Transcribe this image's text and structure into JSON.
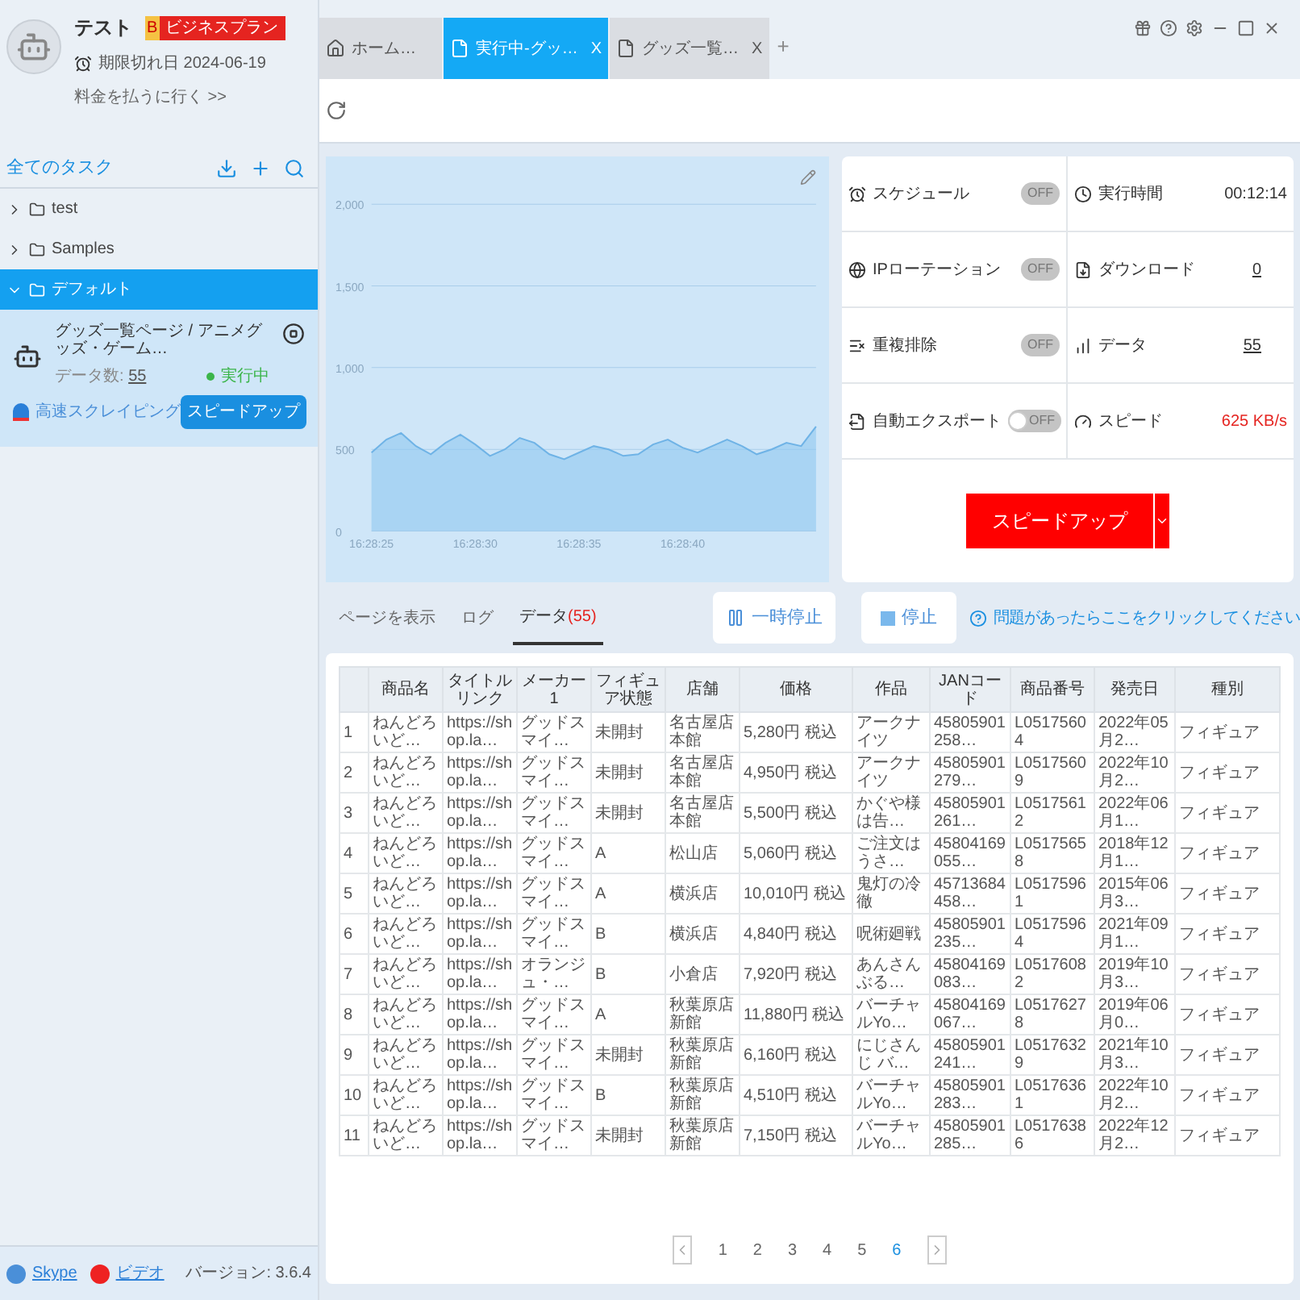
{
  "user": {
    "name": "テスト",
    "plan_badge": "ビジネスプラン",
    "plan_mark": "B",
    "expiry": "期限切れ日 2024-06-19",
    "pay_link": "料金を払うに行く >>"
  },
  "tabs": [
    {
      "label": "ホーム…",
      "kind": "home",
      "selected": false
    },
    {
      "label": "実行中-グッ…",
      "kind": "page",
      "selected": true,
      "close": "X"
    },
    {
      "label": "グッズ一覧…",
      "kind": "page",
      "selected": false,
      "close": "X"
    }
  ],
  "tab_add": "+",
  "sidebar": {
    "title": "全てのタスク",
    "folders": [
      {
        "label": "test",
        "expanded": false,
        "selected": false
      },
      {
        "label": "Samples",
        "expanded": false,
        "selected": false
      },
      {
        "label": "デフォルト",
        "expanded": true,
        "selected": true
      }
    ],
    "task": {
      "title": "グッズ一覧ページ / アニメグッズ・ゲーム…",
      "count_label": "データ数:",
      "count": "55",
      "status": "実行中",
      "mode": "高速スクレイピング",
      "speed_button": "スピードアップ"
    },
    "footer": {
      "skype": "Skype",
      "video": "ビデオ",
      "version": "バージョン: 3.6.4"
    }
  },
  "chart_data": {
    "type": "area",
    "categories": [
      "16:28:25",
      null,
      null,
      null,
      null,
      null,
      null,
      "16:28:30",
      null,
      null,
      null,
      null,
      null,
      null,
      "16:28:35",
      null,
      null,
      null,
      null,
      null,
      null,
      "16:28:40",
      null,
      null,
      null,
      null,
      null,
      null,
      null,
      null,
      null
    ],
    "series": [
      {
        "color": "#90c8f0",
        "values": [
          480,
          560,
          600,
          520,
          470,
          540,
          590,
          530,
          460,
          500,
          570,
          540,
          470,
          440,
          480,
          520,
          500,
          460,
          470,
          530,
          560,
          510,
          480,
          520,
          560,
          520,
          470,
          500,
          540,
          520,
          640
        ]
      }
    ],
    "ylim": [
      0,
      2000
    ],
    "grid": true,
    "yticks": [
      {
        "value": 0,
        "label": "0"
      },
      {
        "value": 500,
        "label": "500"
      },
      {
        "value": 1000,
        "label": "1,000"
      },
      {
        "value": 1500,
        "label": "1,500"
      },
      {
        "value": 2000,
        "label": "2,000"
      }
    ]
  },
  "settings": [
    {
      "label": "スケジュール",
      "toggle": "OFF",
      "disabled": true
    },
    {
      "label": "IPローテーション",
      "toggle": "OFF",
      "disabled": true
    },
    {
      "label": "重複排除",
      "toggle": "OFF",
      "disabled": true
    },
    {
      "label": "自動エクスポート",
      "toggle": "OFF",
      "disabled": false
    }
  ],
  "stats": [
    {
      "label": "実行時間",
      "value": "00:12:14",
      "kind": "text"
    },
    {
      "label": "ダウンロード",
      "value": "0",
      "kind": "link"
    },
    {
      "label": "データ",
      "value": "55",
      "kind": "link"
    },
    {
      "label": "スピード",
      "value": "625 KB/s",
      "kind": "alert"
    }
  ],
  "speed_up": "スピードアップ",
  "view_tabs": [
    {
      "label": "ページを表示",
      "selected": false
    },
    {
      "label": "ログ",
      "selected": false
    },
    {
      "label": "データ",
      "count": "(55)",
      "selected": true
    }
  ],
  "pause": "一時停止",
  "stop": "停止",
  "help": "問題があったらここをクリックしてください",
  "table": {
    "columns": [
      "",
      "商品名",
      "タイトルリンク",
      "メーカー1",
      "フィギュア状態",
      "店舗",
      "価格",
      "作品",
      "JANコード",
      "商品番号",
      "発売日",
      "種別"
    ],
    "rows": [
      [
        "1",
        "ねんどろいど…",
        "https://shop.la…",
        "グッドスマイ…",
        "未開封",
        "名古屋店本館",
        "5,280円 税込",
        "アークナイツ",
        "45805901258…",
        "L05175604",
        "2022年05月2…",
        "フィギュア"
      ],
      [
        "2",
        "ねんどろいど…",
        "https://shop.la…",
        "グッドスマイ…",
        "未開封",
        "名古屋店本館",
        "4,950円 税込",
        "アークナイツ",
        "45805901279…",
        "L05175609",
        "2022年10月2…",
        "フィギュア"
      ],
      [
        "3",
        "ねんどろいど…",
        "https://shop.la…",
        "グッドスマイ…",
        "未開封",
        "名古屋店本館",
        "5,500円 税込",
        "かぐや様は告…",
        "45805901261…",
        "L05175612",
        "2022年06月1…",
        "フィギュア"
      ],
      [
        "4",
        "ねんどろいど…",
        "https://shop.la…",
        "グッドスマイ…",
        "A",
        "松山店",
        "5,060円 税込",
        "ご注文はうさ…",
        "45804169055…",
        "L05175658",
        "2018年12月1…",
        "フィギュア"
      ],
      [
        "5",
        "ねんどろいど…",
        "https://shop.la…",
        "グッドスマイ…",
        "A",
        "横浜店",
        "10,010円 税込",
        "鬼灯の冷徹",
        "45713684458…",
        "L05175961",
        "2015年06月3…",
        "フィギュア"
      ],
      [
        "6",
        "ねんどろいど…",
        "https://shop.la…",
        "グッドスマイ…",
        "B",
        "横浜店",
        "4,840円 税込",
        "呪術廻戦",
        "45805901235…",
        "L05175964",
        "2021年09月1…",
        "フィギュア"
      ],
      [
        "7",
        "ねんどろいど…",
        "https://shop.la…",
        "オランジュ・…",
        "B",
        "小倉店",
        "7,920円 税込",
        "あんさんぶる…",
        "45804169083…",
        "L05176082",
        "2019年10月3…",
        "フィギュア"
      ],
      [
        "8",
        "ねんどろいど…",
        "https://shop.la…",
        "グッドスマイ…",
        "A",
        "秋葉原店新館",
        "11,880円 税込",
        "バーチャルYo…",
        "45804169067…",
        "L05176278",
        "2019年06月0…",
        "フィギュア"
      ],
      [
        "9",
        "ねんどろいど…",
        "https://shop.la…",
        "グッドスマイ…",
        "未開封",
        "秋葉原店新館",
        "6,160円 税込",
        "にじさんじ バ…",
        "45805901241…",
        "L05176329",
        "2021年10月3…",
        "フィギュア"
      ],
      [
        "10",
        "ねんどろいど…",
        "https://shop.la…",
        "グッドスマイ…",
        "B",
        "秋葉原店新館",
        "4,510円 税込",
        "バーチャルYo…",
        "45805901283…",
        "L05176361",
        "2022年10月2…",
        "フィギュア"
      ],
      [
        "11",
        "ねんどろいど…",
        "https://shop.la…",
        "グッドスマイ…",
        "未開封",
        "秋葉原店新館",
        "7,150円 税込",
        "バーチャルYo…",
        "45805901285…",
        "L05176386",
        "2022年12月2…",
        "フィギュア"
      ]
    ]
  },
  "pagination": [
    {
      "label": "1",
      "selected": false
    },
    {
      "label": "2",
      "selected": false
    },
    {
      "label": "3",
      "selected": false
    },
    {
      "label": "4",
      "selected": false
    },
    {
      "label": "5",
      "selected": false
    },
    {
      "label": "6",
      "selected": true
    }
  ]
}
